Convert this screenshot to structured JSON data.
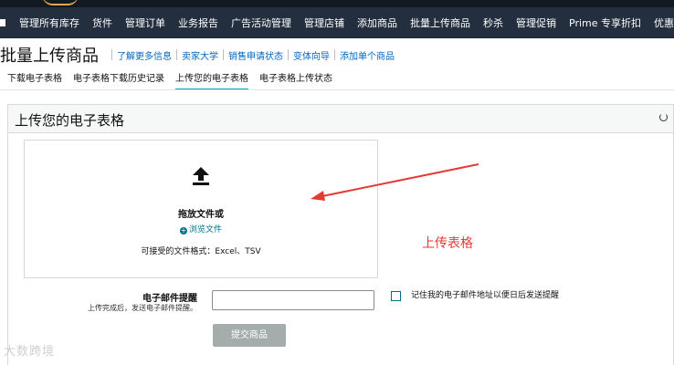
{
  "nav": {
    "items": [
      "管理所有库存",
      "货件",
      "管理订单",
      "业务报告",
      "广告活动管理",
      "管理店铺",
      "添加商品",
      "批量上传商品",
      "秒杀",
      "管理促销",
      "Prime 专享折扣",
      "优惠券"
    ]
  },
  "page": {
    "title": "批量上传商品",
    "links": [
      "了解更多信息",
      "卖家大学",
      "销售申请状态",
      "变体向导",
      "添加单个商品"
    ]
  },
  "tabs": [
    "下载电子表格",
    "电子表格下载历史记录",
    "上传您的电子表格",
    "电子表格上传状态"
  ],
  "panel": {
    "title": "上传您的电子表格",
    "drop_text": "拖放文件或",
    "browse": "浏览文件",
    "formats": "可接受的文件格式：Excel、TSV"
  },
  "annotation": "上传表格",
  "email": {
    "label": "电子邮件提醒",
    "hint": "上传完成后，发送电子邮件提醒。",
    "value": ""
  },
  "remember": "记住我的电子邮件地址以便日后发送提醒",
  "submit": "提交商品",
  "watermark": "大数跨境",
  "colors": {
    "accent": "#00a8a8",
    "link": "#0066c0",
    "annotation": "#e53935",
    "navbar": "#232f3e"
  }
}
